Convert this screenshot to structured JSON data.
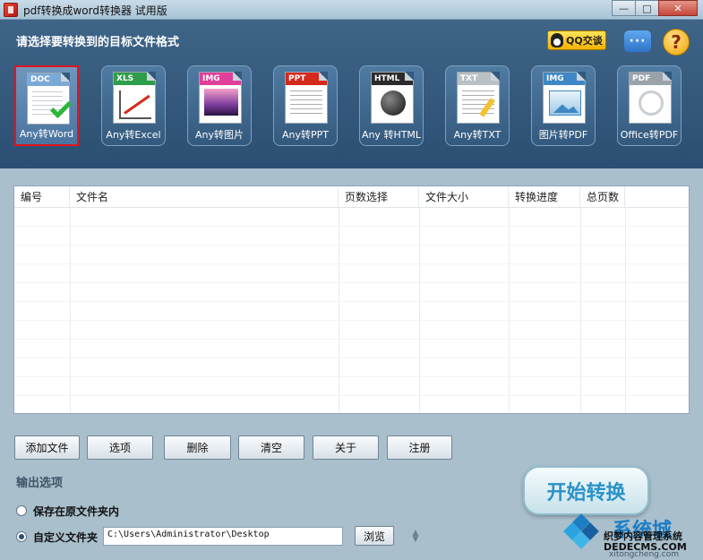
{
  "window": {
    "title": "pdf转换成word转换器 试用版",
    "controls": {
      "minimize": "—",
      "maximize": "□",
      "close": "✕"
    }
  },
  "header": {
    "prompt": "请选择要转换到的目标文件格式",
    "qq_label": "QQ交谈",
    "chat_glyph": "···",
    "help_glyph": "?"
  },
  "formats": [
    {
      "tag": "DOC",
      "label": "Any转Word",
      "color": "#7aa9d8",
      "art": "check",
      "selected": true
    },
    {
      "tag": "XLS",
      "label": "Any转Excel",
      "color": "#2e9e4a",
      "art": "chart",
      "selected": false
    },
    {
      "tag": "IMG",
      "label": "Any转图片",
      "color": "#e0409a",
      "art": "pic",
      "selected": false
    },
    {
      "tag": "PPT",
      "label": "Any转PPT",
      "color": "#d42a1c",
      "art": "txt",
      "selected": false
    },
    {
      "tag": "HTML",
      "label": "Any 转HTML",
      "color": "#2b2b2b",
      "art": "html",
      "selected": false
    },
    {
      "tag": "TXT",
      "label": "Any转TXT",
      "color": "#b9c0c6",
      "art": "pen",
      "selected": false
    },
    {
      "tag": "IMG",
      "label": "图片转PDF",
      "color": "#3f88c5",
      "art": "img",
      "selected": false
    },
    {
      "tag": "PDF",
      "label": "Office转PDF",
      "color": "#9aa3aa",
      "art": "pdf",
      "selected": false
    }
  ],
  "table": {
    "columns": [
      "编号",
      "文件名",
      "页数选择",
      "文件大小",
      "转换进度",
      "总页数"
    ],
    "rows": []
  },
  "buttons": {
    "add_file": "添加文件",
    "options": "选项",
    "delete": "删除",
    "clear": "清空",
    "about": "关于",
    "register": "注册",
    "browse": "浏览",
    "start": "开始转换"
  },
  "output": {
    "title": "输出选项",
    "save_original": "保存在原文件夹内",
    "custom_folder": "自定义文件夹",
    "selected": "custom_folder",
    "path": "C:\\Users\\Administrator\\Desktop"
  },
  "watermark": {
    "brand": "系统城",
    "line1": "织梦内容管理系统",
    "url": "DEDECMS.COM",
    "sub": "xitongcheng.com"
  }
}
